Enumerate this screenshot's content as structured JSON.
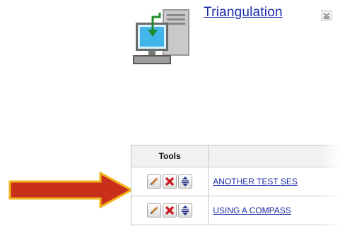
{
  "header": {
    "title": "Triangulation",
    "computer_icon": "computer-download-icon",
    "menu_icon": "menu-lines-icon"
  },
  "table": {
    "columns": [
      "Tools",
      ""
    ],
    "rows": [
      {
        "title": "ANOTHER TEST SES",
        "tools": [
          "edit-icon",
          "delete-icon",
          "move-icon"
        ],
        "highlighted": true
      },
      {
        "title": "USING A COMPASS",
        "tools": [
          "edit-icon",
          "delete-icon",
          "move-icon"
        ],
        "highlighted": false
      }
    ]
  },
  "annotation": {
    "arrow_icon": "red-arrow-icon",
    "arrow_fill": "#c8301b",
    "arrow_outline": "#f2b318"
  },
  "colors": {
    "link": "#1a2ba8",
    "header_bg": "#f1f1f1",
    "border": "#c4c4c4",
    "delete": "#c8171c",
    "move": "#2c3a8c"
  }
}
